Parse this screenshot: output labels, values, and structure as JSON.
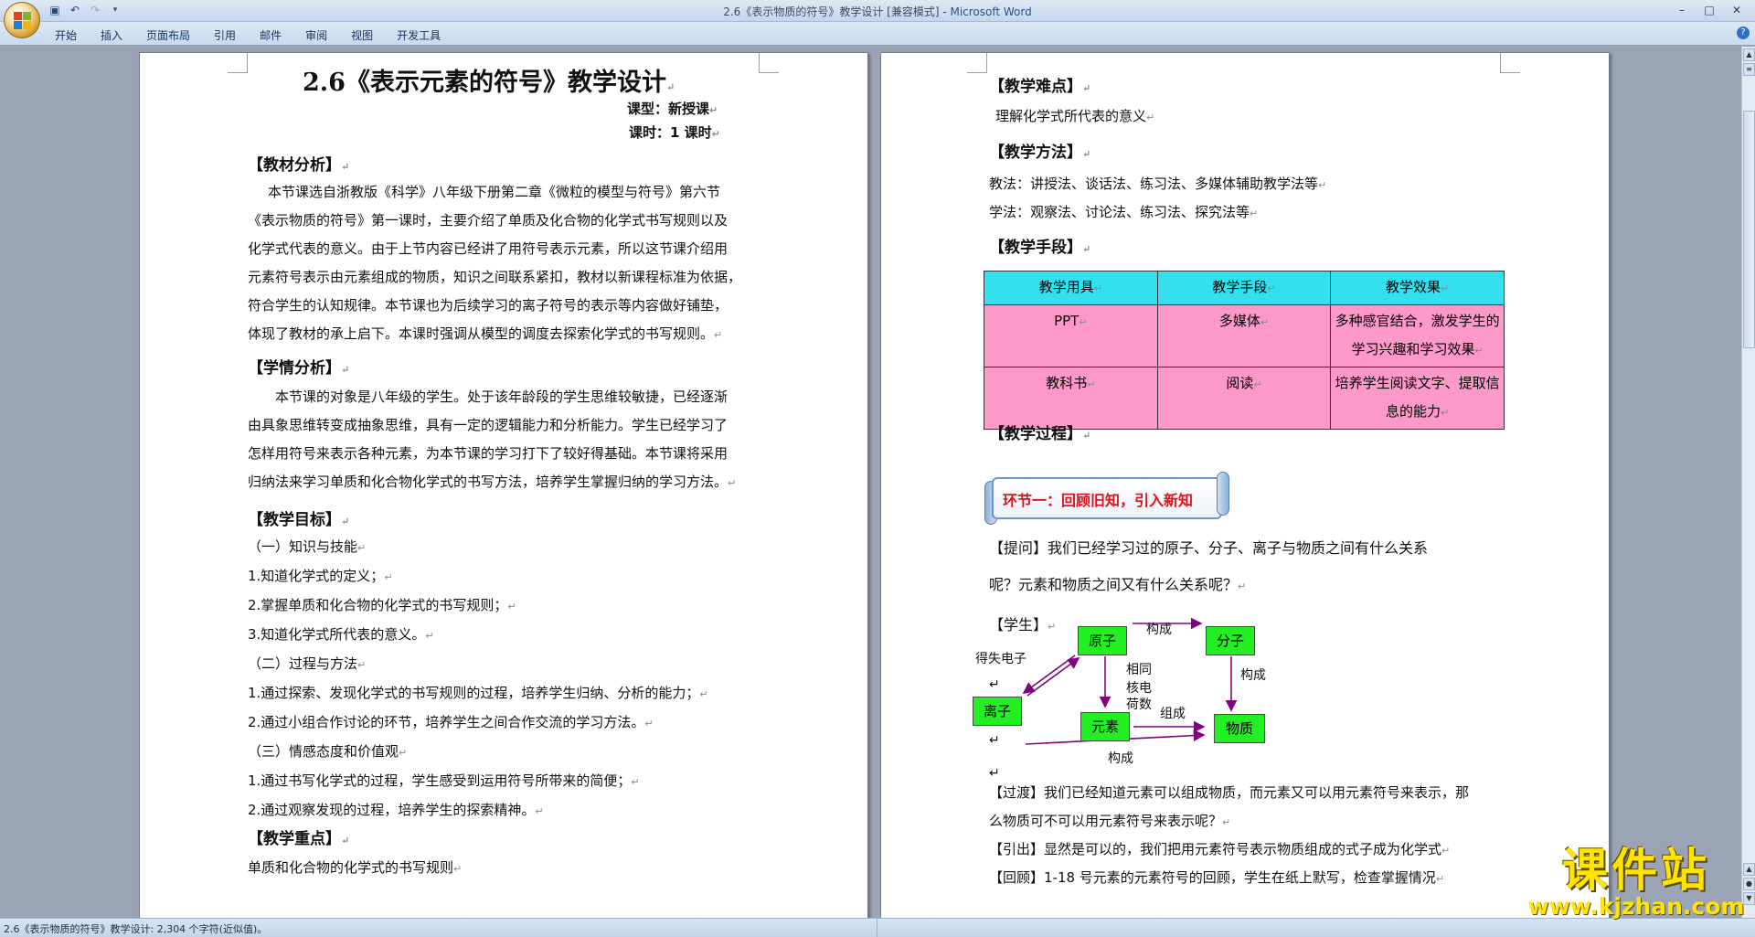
{
  "window": {
    "title_doc": "2.6《表示物质的符号》教学设计 [兼容模式] - ",
    "title_app": "Microsoft Word"
  },
  "ribbon": {
    "tabs": [
      "开始",
      "插入",
      "页面布局",
      "引用",
      "邮件",
      "审阅",
      "视图",
      "开发工具"
    ]
  },
  "status": {
    "text": "2.6《表示物质的符号》教学设计: 2,304 个字符(近似值)。"
  },
  "left_page": {
    "title": "2.6《表示元素的符号》教学设计",
    "lesson_type": "课型：新授课",
    "lesson_hours": "课时：1 课时",
    "h1": "【教材分析】",
    "p1": [
      "本节课选自浙教版《科学》八年级下册第二章《微粒的模型与符号》第六节",
      "《表示物质的符号》第一课时，主要介绍了单质及化合物的化学式书写规则以及",
      "化学式代表的意义。由于上节内容已经讲了用符号表示元素，所以这节课介绍用",
      "元素符号表示由元素组成的物质，知识之间联系紧扣，教材以新课程标准为依据，",
      "符合学生的认知规律。本节课也为后续学习的离子符号的表示等内容做好铺垫，",
      "体现了教材的承上启下。本课时强调从模型的调度去探索化学式的书写规则。"
    ],
    "h2": "【学情分析】",
    "p2": [
      "本节课的对象是八年级的学生。处于该年龄段的学生思维较敏捷，已经逐渐",
      "由具象思维转变成抽象思维，具有一定的逻辑能力和分析能力。学生已经学习了",
      "怎样用符号来表示各种元素，为本节课的学习打下了较好得基础。本节课将采用",
      "归纳法来学习单质和化合物化学式的书写方法，培养学生掌握归纳的学习方法。"
    ],
    "h3": "【教学目标】",
    "goals": [
      "（一）知识与技能",
      "1.知道化学式的定义；",
      "2.掌握单质和化合物的化学式的书写规则；",
      "3.知道化学式所代表的意义。",
      "（二）过程与方法",
      "1.通过探索、发现化学式的书写规则的过程，培养学生归纳、分析的能力；",
      "2.通过小组合作讨论的环节，培养学生之间合作交流的学习方法。",
      "（三）情感态度和价值观",
      "1.通过书写化学式的过程，学生感受到运用符号所带来的简便；",
      "2.通过观察发现的过程，培养学生的探索精神。"
    ],
    "h4": "【教学重点】",
    "key": "单质和化合物的化学式的书写规则"
  },
  "right_page": {
    "h1": "【教学难点】",
    "difficulty": "理解化学式所代表的意义",
    "h2": "【教学方法】",
    "method1": "教法：讲授法、谈话法、练习法、多媒体辅助教学法等",
    "method2": "学法：观察法、讨论法、练习法、探究法等",
    "h3": "【教学手段】",
    "table": {
      "headers": [
        "教学用具",
        "教学手段",
        "教学效果"
      ],
      "rows": [
        [
          "PPT",
          "多媒体",
          "多种感官结合，激发学生的学习兴趣和学习效果"
        ],
        [
          "教科书",
          "阅读",
          "培养学生阅读文字、提取信息的能力"
        ]
      ]
    },
    "h4": "【教学过程】",
    "banner": "环节一：回顾旧知，引入新知",
    "question_1": "【提问】我们已经学习过的原子、分子、离子与物质之间有什么关系",
    "question_2": "呢？元素和物质之间又有什么关系呢？",
    "student": "【学生】",
    "diagram": {
      "nodes": {
        "atom": "原子",
        "molecule": "分子",
        "ion": "离子",
        "element": "元素",
        "substance": "物质"
      },
      "labels": {
        "gain_lose": "得失电子",
        "constitute_top": "构成",
        "constitute_right": "构成",
        "same_charge": [
          "相同",
          "核电",
          "荷数"
        ],
        "compose": "组成",
        "constitute_bottom": "构成"
      }
    },
    "transition_1": "【过渡】我们已经知道元素可以组成物质，而元素又可以用元素符号来表示，那",
    "transition_2": "么物质可不可以用元素符号来表示呢？",
    "lead": "【引出】显然是可以的，我们把用元素符号表示物质组成的式子成为化学式",
    "review": "【回顾】1-18 号元素的元素符号的回顾，学生在纸上默写，检查掌握情况"
  },
  "watermark": {
    "cn": "课件站",
    "url": "www.kjzhan.com"
  }
}
